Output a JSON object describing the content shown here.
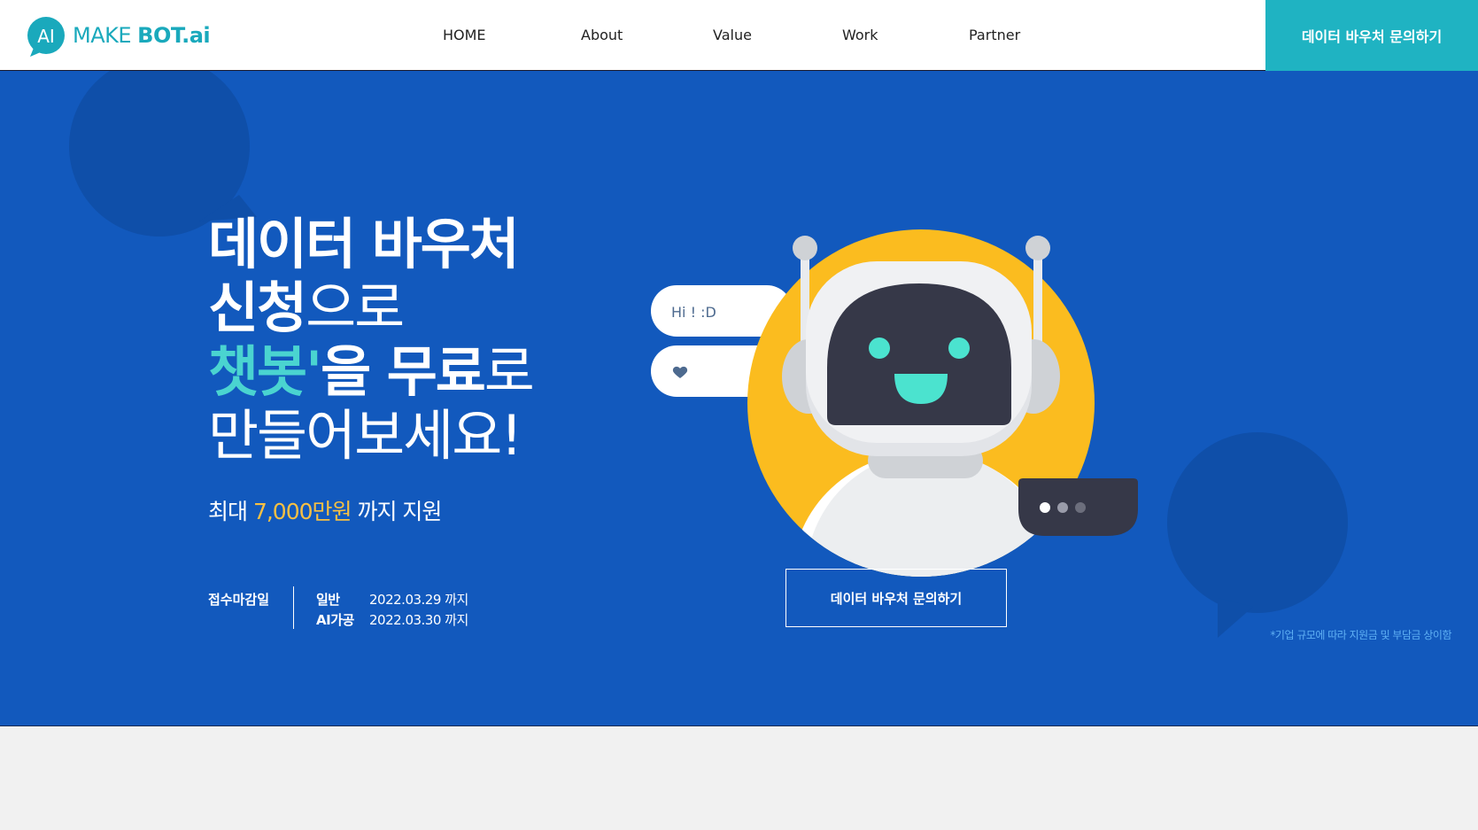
{
  "header": {
    "logo": {
      "prefix": "MAKE ",
      "suffix": "BOT.ai",
      "mark_text": "AI"
    },
    "nav": [
      {
        "label": "HOME"
      },
      {
        "label": "About"
      },
      {
        "label": "Value"
      },
      {
        "label": "Work"
      },
      {
        "label": "Partner"
      }
    ],
    "cta_label": "데이터 바우처 문의하기"
  },
  "hero": {
    "headline": {
      "line1": "데이터 바우처",
      "line2_bold": "신청",
      "line2_light": "으로",
      "line3_teal": "챗봇'",
      "line3_bold": "을 무료",
      "line3_light": "로",
      "line4": "만들어보세요!"
    },
    "subline": {
      "prefix": "최대 ",
      "amount": "7,000만원",
      "suffix": " 까지 지원"
    },
    "deadline": {
      "label": "접수마감일",
      "rows": [
        {
          "key": "일반",
          "value": "2022.03.29 까지"
        },
        {
          "key": "AI가공",
          "value": "2022.03.30 까지"
        }
      ]
    },
    "chat_bubble_text": "Hi ! :D",
    "cta_label": "데이터 바우처 문의하기",
    "footnote": "*기업 규모에 따라 지원금 및 부담금 상이함"
  },
  "colors": {
    "hero_bg": "#1259bd",
    "accent_teal": "#1fb3c2",
    "amount_yellow": "#f7c043",
    "robot_circle": "#fbbc1f",
    "robot_face": "#363848",
    "robot_eyes": "#4be3cf"
  },
  "icons": [
    "heart-icon",
    "typing-dots-icon",
    "speech-bubble-icon"
  ]
}
